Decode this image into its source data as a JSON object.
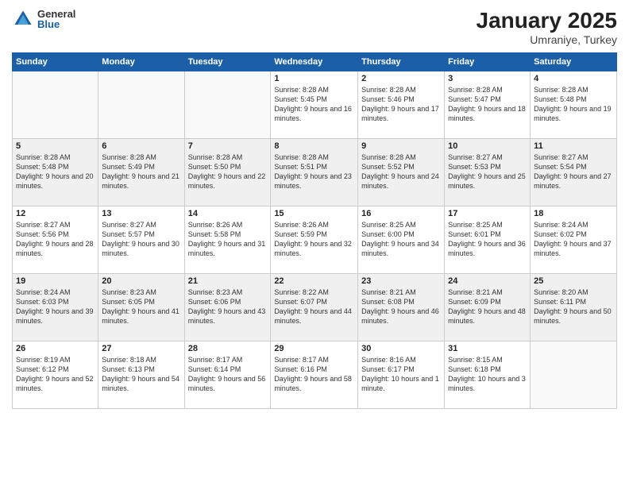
{
  "logo": {
    "general": "General",
    "blue": "Blue"
  },
  "title": "January 2025",
  "location": "Umraniye, Turkey",
  "days_of_week": [
    "Sunday",
    "Monday",
    "Tuesday",
    "Wednesday",
    "Thursday",
    "Friday",
    "Saturday"
  ],
  "weeks": [
    [
      {
        "day": "",
        "sunrise": "",
        "sunset": "",
        "daylight": ""
      },
      {
        "day": "",
        "sunrise": "",
        "sunset": "",
        "daylight": ""
      },
      {
        "day": "",
        "sunrise": "",
        "sunset": "",
        "daylight": ""
      },
      {
        "day": "1",
        "sunrise": "Sunrise: 8:28 AM",
        "sunset": "Sunset: 5:45 PM",
        "daylight": "Daylight: 9 hours and 16 minutes."
      },
      {
        "day": "2",
        "sunrise": "Sunrise: 8:28 AM",
        "sunset": "Sunset: 5:46 PM",
        "daylight": "Daylight: 9 hours and 17 minutes."
      },
      {
        "day": "3",
        "sunrise": "Sunrise: 8:28 AM",
        "sunset": "Sunset: 5:47 PM",
        "daylight": "Daylight: 9 hours and 18 minutes."
      },
      {
        "day": "4",
        "sunrise": "Sunrise: 8:28 AM",
        "sunset": "Sunset: 5:48 PM",
        "daylight": "Daylight: 9 hours and 19 minutes."
      }
    ],
    [
      {
        "day": "5",
        "sunrise": "Sunrise: 8:28 AM",
        "sunset": "Sunset: 5:48 PM",
        "daylight": "Daylight: 9 hours and 20 minutes."
      },
      {
        "day": "6",
        "sunrise": "Sunrise: 8:28 AM",
        "sunset": "Sunset: 5:49 PM",
        "daylight": "Daylight: 9 hours and 21 minutes."
      },
      {
        "day": "7",
        "sunrise": "Sunrise: 8:28 AM",
        "sunset": "Sunset: 5:50 PM",
        "daylight": "Daylight: 9 hours and 22 minutes."
      },
      {
        "day": "8",
        "sunrise": "Sunrise: 8:28 AM",
        "sunset": "Sunset: 5:51 PM",
        "daylight": "Daylight: 9 hours and 23 minutes."
      },
      {
        "day": "9",
        "sunrise": "Sunrise: 8:28 AM",
        "sunset": "Sunset: 5:52 PM",
        "daylight": "Daylight: 9 hours and 24 minutes."
      },
      {
        "day": "10",
        "sunrise": "Sunrise: 8:27 AM",
        "sunset": "Sunset: 5:53 PM",
        "daylight": "Daylight: 9 hours and 25 minutes."
      },
      {
        "day": "11",
        "sunrise": "Sunrise: 8:27 AM",
        "sunset": "Sunset: 5:54 PM",
        "daylight": "Daylight: 9 hours and 27 minutes."
      }
    ],
    [
      {
        "day": "12",
        "sunrise": "Sunrise: 8:27 AM",
        "sunset": "Sunset: 5:56 PM",
        "daylight": "Daylight: 9 hours and 28 minutes."
      },
      {
        "day": "13",
        "sunrise": "Sunrise: 8:27 AM",
        "sunset": "Sunset: 5:57 PM",
        "daylight": "Daylight: 9 hours and 30 minutes."
      },
      {
        "day": "14",
        "sunrise": "Sunrise: 8:26 AM",
        "sunset": "Sunset: 5:58 PM",
        "daylight": "Daylight: 9 hours and 31 minutes."
      },
      {
        "day": "15",
        "sunrise": "Sunrise: 8:26 AM",
        "sunset": "Sunset: 5:59 PM",
        "daylight": "Daylight: 9 hours and 32 minutes."
      },
      {
        "day": "16",
        "sunrise": "Sunrise: 8:25 AM",
        "sunset": "Sunset: 6:00 PM",
        "daylight": "Daylight: 9 hours and 34 minutes."
      },
      {
        "day": "17",
        "sunrise": "Sunrise: 8:25 AM",
        "sunset": "Sunset: 6:01 PM",
        "daylight": "Daylight: 9 hours and 36 minutes."
      },
      {
        "day": "18",
        "sunrise": "Sunrise: 8:24 AM",
        "sunset": "Sunset: 6:02 PM",
        "daylight": "Daylight: 9 hours and 37 minutes."
      }
    ],
    [
      {
        "day": "19",
        "sunrise": "Sunrise: 8:24 AM",
        "sunset": "Sunset: 6:03 PM",
        "daylight": "Daylight: 9 hours and 39 minutes."
      },
      {
        "day": "20",
        "sunrise": "Sunrise: 8:23 AM",
        "sunset": "Sunset: 6:05 PM",
        "daylight": "Daylight: 9 hours and 41 minutes."
      },
      {
        "day": "21",
        "sunrise": "Sunrise: 8:23 AM",
        "sunset": "Sunset: 6:06 PM",
        "daylight": "Daylight: 9 hours and 43 minutes."
      },
      {
        "day": "22",
        "sunrise": "Sunrise: 8:22 AM",
        "sunset": "Sunset: 6:07 PM",
        "daylight": "Daylight: 9 hours and 44 minutes."
      },
      {
        "day": "23",
        "sunrise": "Sunrise: 8:21 AM",
        "sunset": "Sunset: 6:08 PM",
        "daylight": "Daylight: 9 hours and 46 minutes."
      },
      {
        "day": "24",
        "sunrise": "Sunrise: 8:21 AM",
        "sunset": "Sunset: 6:09 PM",
        "daylight": "Daylight: 9 hours and 48 minutes."
      },
      {
        "day": "25",
        "sunrise": "Sunrise: 8:20 AM",
        "sunset": "Sunset: 6:11 PM",
        "daylight": "Daylight: 9 hours and 50 minutes."
      }
    ],
    [
      {
        "day": "26",
        "sunrise": "Sunrise: 8:19 AM",
        "sunset": "Sunset: 6:12 PM",
        "daylight": "Daylight: 9 hours and 52 minutes."
      },
      {
        "day": "27",
        "sunrise": "Sunrise: 8:18 AM",
        "sunset": "Sunset: 6:13 PM",
        "daylight": "Daylight: 9 hours and 54 minutes."
      },
      {
        "day": "28",
        "sunrise": "Sunrise: 8:17 AM",
        "sunset": "Sunset: 6:14 PM",
        "daylight": "Daylight: 9 hours and 56 minutes."
      },
      {
        "day": "29",
        "sunrise": "Sunrise: 8:17 AM",
        "sunset": "Sunset: 6:16 PM",
        "daylight": "Daylight: 9 hours and 58 minutes."
      },
      {
        "day": "30",
        "sunrise": "Sunrise: 8:16 AM",
        "sunset": "Sunset: 6:17 PM",
        "daylight": "Daylight: 10 hours and 1 minute."
      },
      {
        "day": "31",
        "sunrise": "Sunrise: 8:15 AM",
        "sunset": "Sunset: 6:18 PM",
        "daylight": "Daylight: 10 hours and 3 minutes."
      },
      {
        "day": "",
        "sunrise": "",
        "sunset": "",
        "daylight": ""
      }
    ]
  ]
}
